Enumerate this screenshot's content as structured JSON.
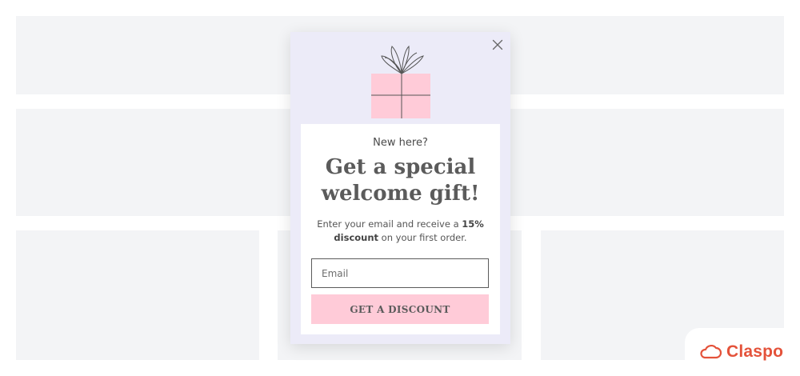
{
  "popup": {
    "eyebrow": "New here?",
    "heading_line1": "Get a special",
    "heading_line2": "welcome gift!",
    "desc_pre": "Enter your email and receive a ",
    "desc_bold1": "15%",
    "desc_bold2": "discount",
    "desc_post": " on your first order.",
    "email_placeholder": "Email",
    "cta_label": "GET A DISCOUNT"
  },
  "brand": {
    "name": "Claspo"
  },
  "colors": {
    "popup_bg": "#ecebf8",
    "gift_fill": "#ffcbd8",
    "cta_bg": "#ffcbd8",
    "brand": "#e4523a",
    "placeholder_block": "#f3f4f6"
  },
  "icons": [
    "close-icon",
    "gift-icon",
    "cloud-logo-icon"
  ]
}
